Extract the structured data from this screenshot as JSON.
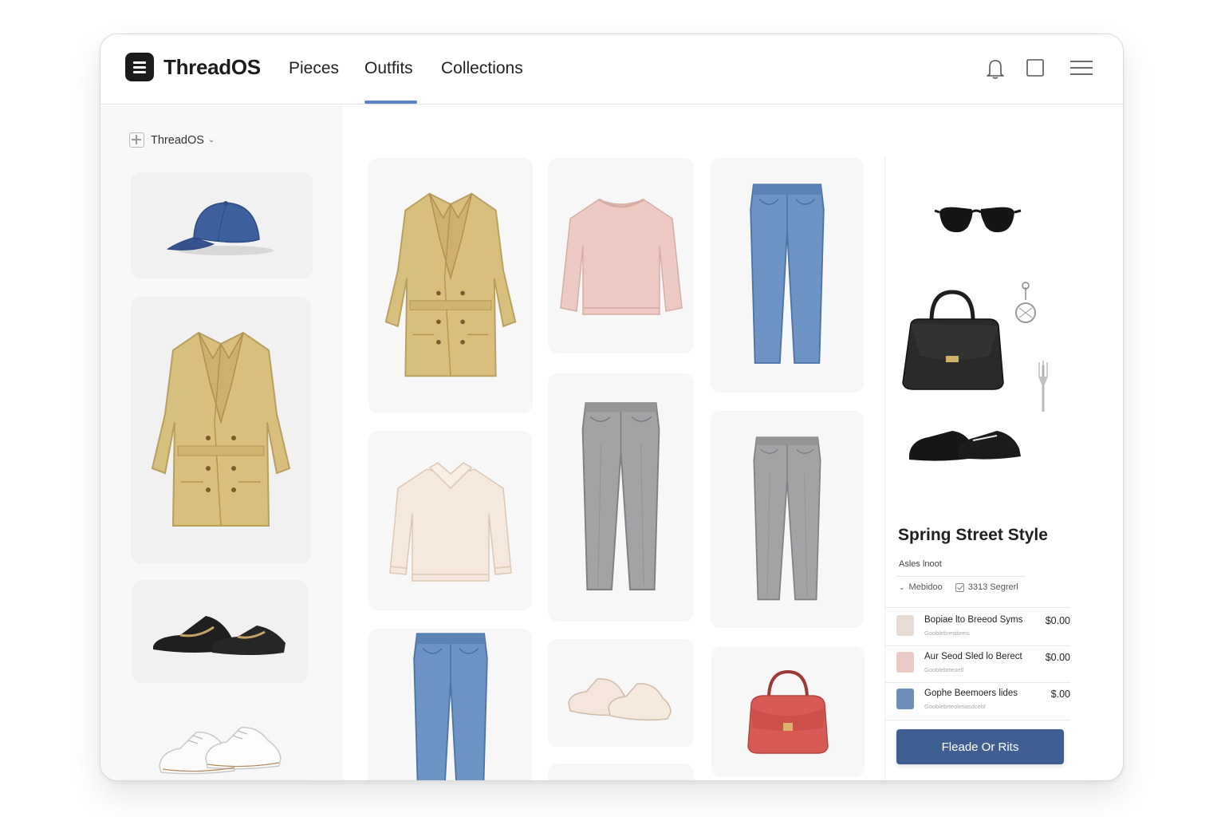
{
  "app": {
    "brand": "ThreadOS",
    "logo_icon": "menu-lines-icon"
  },
  "nav": {
    "tabs": [
      {
        "label": "Pieces",
        "active": false
      },
      {
        "label": "Outfits",
        "active": true
      },
      {
        "label": "Collections",
        "active": false
      }
    ],
    "accent_color": "#5b84c4"
  },
  "header_icons": [
    "bell-icon",
    "square-icon",
    "hamburger-menu-icon"
  ],
  "sidebar": {
    "workspace_label": "ThreadOS",
    "workspace_chevron": "⌄",
    "items": [
      {
        "icon": "blue-baseball-cap"
      },
      {
        "icon": "camel-trench-coat"
      },
      {
        "icon": "black-loafers"
      },
      {
        "icon": "white-sneakers"
      }
    ]
  },
  "grid": {
    "items": [
      {
        "icon": "camel-trench-coat"
      },
      {
        "icon": "pink-sweater"
      },
      {
        "icon": "blue-jeans"
      },
      {
        "icon": "cream-collared-sweater"
      },
      {
        "icon": "grey-trousers"
      },
      {
        "icon": "grey-trousers"
      },
      {
        "icon": "blue-jeans"
      },
      {
        "icon": "cream-slip-on-shoes"
      },
      {
        "icon": "red-handbag"
      }
    ]
  },
  "outfit": {
    "preview_items": [
      "black-sunglasses",
      "black-handbag",
      "silver-charm",
      "fork",
      "black-loafers"
    ],
    "title": "Spring Street Style",
    "subtitle": "Asles lnoot",
    "meta_left": "Mebidoo",
    "meta_right": "3313 Segrerl",
    "items": [
      {
        "name": "Bopiae lto Breeod Syms",
        "sub": "Gooblebrestteeis",
        "price": "$0.00",
        "thumb_color": "#e8dcd6"
      },
      {
        "name": "Aur Seod Sled lo Berect",
        "sub": "Gooblebrteoetl",
        "price": "$0.00",
        "thumb_color": "#ecc9c4"
      },
      {
        "name": "Gophe Beemoers lides",
        "sub": "Gooblebrteoletiasdcebl",
        "price": "$.00",
        "thumb_color": "#6f8fb8"
      }
    ],
    "cta_label": "Fleade Or Rits",
    "cta_color": "#3f5f93"
  }
}
